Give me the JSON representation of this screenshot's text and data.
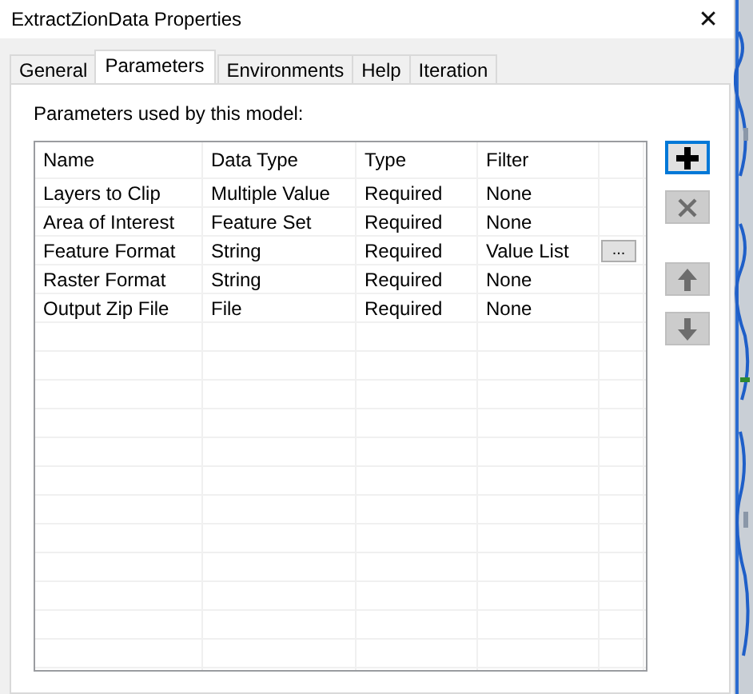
{
  "window": {
    "title": "ExtractZionData Properties",
    "close": "✕"
  },
  "tabs": [
    {
      "label": "General",
      "selected": false
    },
    {
      "label": "Parameters",
      "selected": true
    },
    {
      "label": "Environments",
      "selected": false
    },
    {
      "label": "Help",
      "selected": false
    },
    {
      "label": "Iteration",
      "selected": false
    }
  ],
  "panel": {
    "caption": "Parameters used by this model:"
  },
  "table": {
    "columns": [
      "Name",
      "Data Type",
      "Type",
      "Filter"
    ],
    "rows": [
      {
        "cells": [
          "Layers to Clip",
          "Multiple Value",
          "Required",
          "None"
        ],
        "has_browse": false
      },
      {
        "cells": [
          "Area of Interest",
          "Feature Set",
          "Required",
          "None"
        ],
        "has_browse": false
      },
      {
        "cells": [
          "Feature Format",
          "String",
          "Required",
          "Value List"
        ],
        "has_browse": true,
        "browse_label": "..."
      },
      {
        "cells": [
          "Raster Format",
          "String",
          "Required",
          "None"
        ],
        "has_browse": false
      },
      {
        "cells": [
          "Output Zip File",
          "File",
          "Required",
          "None"
        ],
        "has_browse": false
      }
    ]
  },
  "side_buttons": [
    {
      "kind": "add",
      "disabled": false,
      "focused": true
    },
    {
      "kind": "delete",
      "disabled": true,
      "focused": false
    },
    {
      "kind": "up",
      "disabled": true,
      "focused": false
    },
    {
      "kind": "down",
      "disabled": true,
      "focused": false
    }
  ]
}
